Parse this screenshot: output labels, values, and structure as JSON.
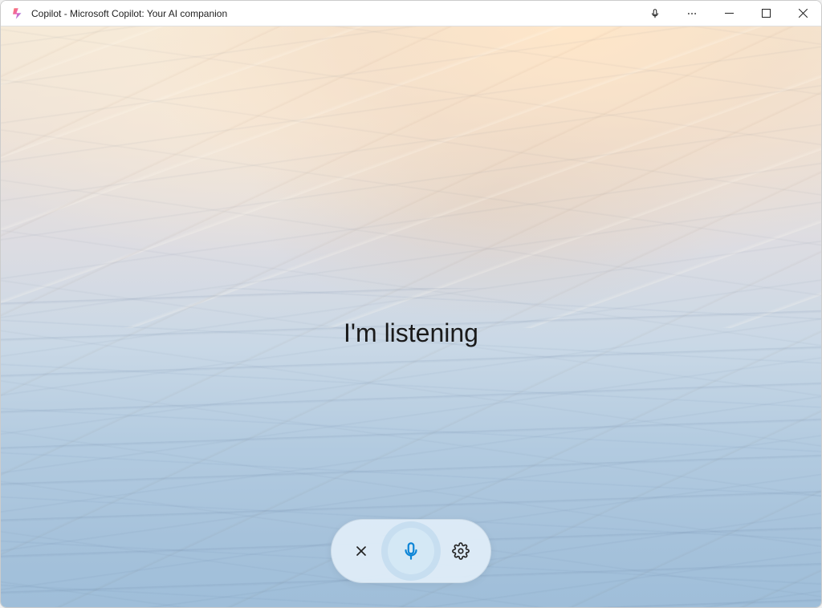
{
  "window": {
    "title": "Copilot - Microsoft Copilot: Your AI companion"
  },
  "main": {
    "status_text": "I'm listening"
  },
  "icons": {
    "app": "copilot-icon",
    "titlebar_mic": "microphone-icon",
    "more": "more-icon",
    "minimize": "minimize-icon",
    "maximize": "maximize-icon",
    "close": "close-icon",
    "pill_close": "close-icon",
    "pill_mic": "microphone-icon",
    "pill_settings": "gear-icon"
  }
}
